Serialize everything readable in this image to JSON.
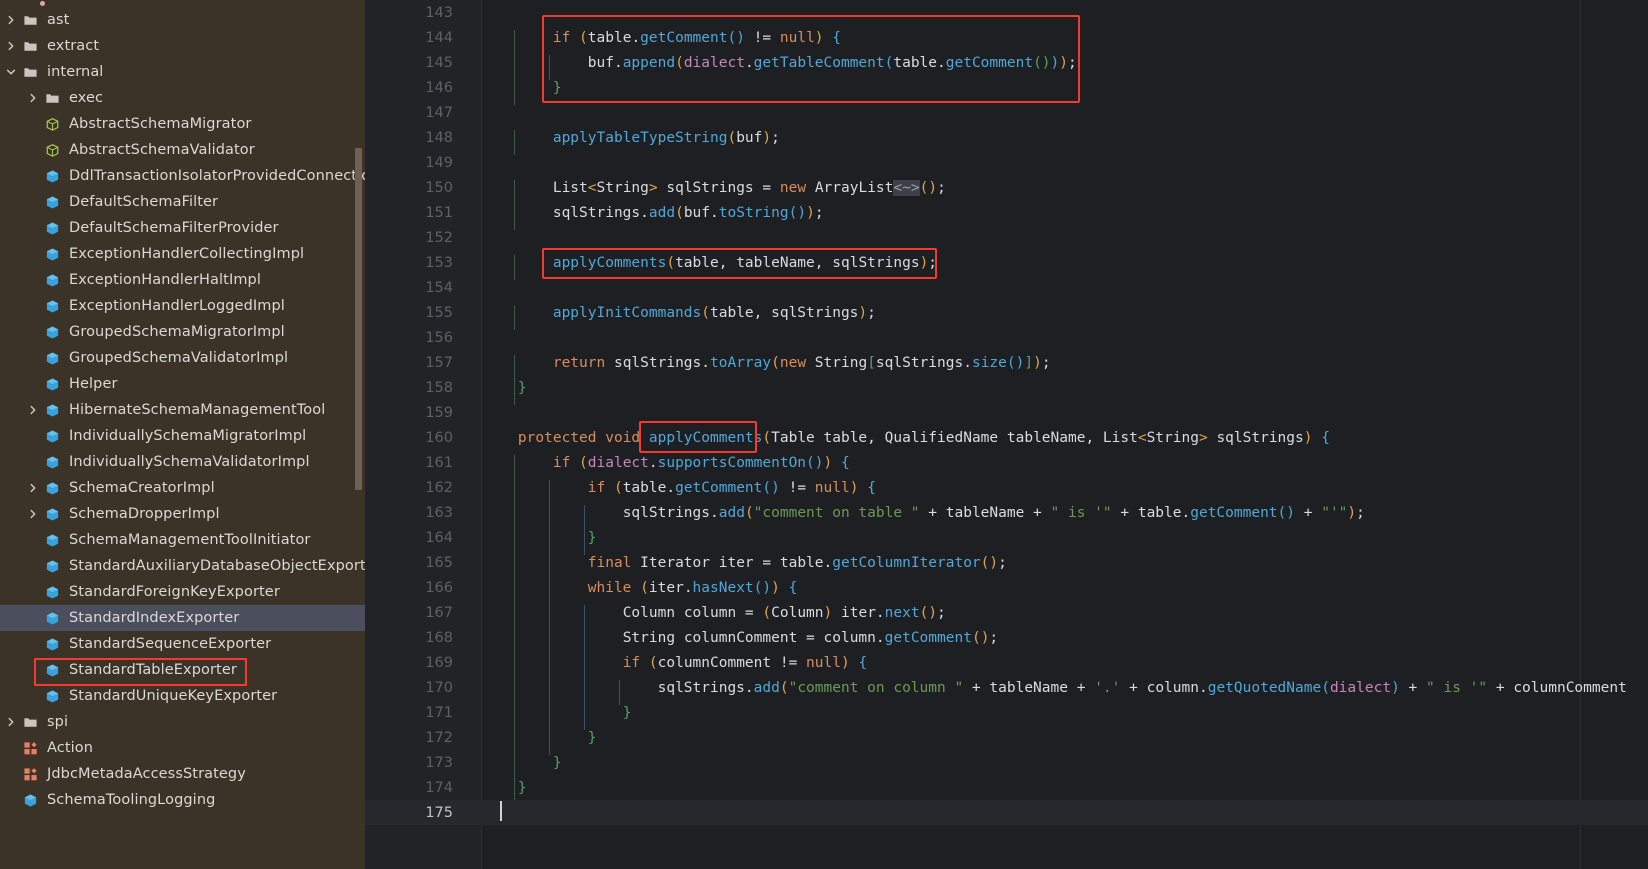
{
  "sidebar": {
    "bg_color": "#3b3228",
    "selected_bg": "#4b4e5c",
    "highlight_color": "#f4392f",
    "items": [
      {
        "label": "ast",
        "icon": "folder-icon",
        "indent": 0,
        "chevron": "right",
        "state": "collapsed"
      },
      {
        "label": "extract",
        "icon": "folder-icon",
        "indent": 0,
        "chevron": "right",
        "state": "collapsed"
      },
      {
        "label": "internal",
        "icon": "folder-icon",
        "indent": 0,
        "chevron": "down",
        "state": "expanded"
      },
      {
        "label": "exec",
        "icon": "folder-icon",
        "indent": 1,
        "chevron": "right",
        "state": "collapsed"
      },
      {
        "label": "AbstractSchemaMigrator",
        "icon": "abstract-class-icon",
        "indent": 1,
        "chevron": "none"
      },
      {
        "label": "AbstractSchemaValidator",
        "icon": "abstract-class-icon",
        "indent": 1,
        "chevron": "none"
      },
      {
        "label": "DdlTransactionIsolatorProvidedConnectionImpl",
        "icon": "class-icon",
        "indent": 1,
        "chevron": "none"
      },
      {
        "label": "DefaultSchemaFilter",
        "icon": "class-icon",
        "indent": 1,
        "chevron": "none"
      },
      {
        "label": "DefaultSchemaFilterProvider",
        "icon": "class-icon",
        "indent": 1,
        "chevron": "none"
      },
      {
        "label": "ExceptionHandlerCollectingImpl",
        "icon": "class-icon",
        "indent": 1,
        "chevron": "none"
      },
      {
        "label": "ExceptionHandlerHaltImpl",
        "icon": "class-icon",
        "indent": 1,
        "chevron": "none"
      },
      {
        "label": "ExceptionHandlerLoggedImpl",
        "icon": "class-icon",
        "indent": 1,
        "chevron": "none"
      },
      {
        "label": "GroupedSchemaMigratorImpl",
        "icon": "class-icon",
        "indent": 1,
        "chevron": "none"
      },
      {
        "label": "GroupedSchemaValidatorImpl",
        "icon": "class-icon",
        "indent": 1,
        "chevron": "none"
      },
      {
        "label": "Helper",
        "icon": "class-icon",
        "indent": 1,
        "chevron": "none"
      },
      {
        "label": "HibernateSchemaManagementTool",
        "icon": "class-icon",
        "indent": 1,
        "chevron": "right",
        "state": "collapsed"
      },
      {
        "label": "IndividuallySchemaMigratorImpl",
        "icon": "class-icon",
        "indent": 1,
        "chevron": "none"
      },
      {
        "label": "IndividuallySchemaValidatorImpl",
        "icon": "class-icon",
        "indent": 1,
        "chevron": "none"
      },
      {
        "label": "SchemaCreatorImpl",
        "icon": "class-icon",
        "indent": 1,
        "chevron": "right",
        "state": "collapsed"
      },
      {
        "label": "SchemaDropperImpl",
        "icon": "class-icon",
        "indent": 1,
        "chevron": "right",
        "state": "collapsed"
      },
      {
        "label": "SchemaManagementToolInitiator",
        "icon": "class-icon",
        "indent": 1,
        "chevron": "none"
      },
      {
        "label": "StandardAuxiliaryDatabaseObjectExporter",
        "icon": "class-icon",
        "indent": 1,
        "chevron": "none"
      },
      {
        "label": "StandardForeignKeyExporter",
        "icon": "class-icon",
        "indent": 1,
        "chevron": "none"
      },
      {
        "label": "StandardIndexExporter",
        "icon": "class-icon",
        "indent": 1,
        "chevron": "none",
        "selected": true
      },
      {
        "label": "StandardSequenceExporter",
        "icon": "class-icon",
        "indent": 1,
        "chevron": "none"
      },
      {
        "label": "StandardTableExporter",
        "icon": "class-icon",
        "indent": 1,
        "chevron": "none",
        "boxed": true
      },
      {
        "label": "StandardUniqueKeyExporter",
        "icon": "class-icon",
        "indent": 1,
        "chevron": "none"
      },
      {
        "label": "spi",
        "icon": "folder-icon",
        "indent": 0,
        "chevron": "right",
        "state": "collapsed"
      },
      {
        "label": "Action",
        "icon": "enum-icon",
        "indent": 0,
        "chevron": "none"
      },
      {
        "label": "JdbcMetadaAccessStrategy",
        "icon": "enum-icon",
        "indent": 0,
        "chevron": "none"
      },
      {
        "label": "SchemaToolingLogging",
        "icon": "class-icon",
        "indent": 0,
        "chevron": "none"
      }
    ]
  },
  "editor": {
    "background": "#1e1f23",
    "gutter_background": "#222327",
    "active_line": 175,
    "first_line": 143,
    "last_line": 175,
    "colors": {
      "keyword": "#d98d5b",
      "string": "#6a9955",
      "method": "#4fa8d8",
      "field": "#c586c0",
      "plain": "#d8dbe0",
      "line_number": "#5d6066",
      "highlight_box": "#f4392f"
    },
    "line_numbers": [
      143,
      144,
      145,
      146,
      147,
      148,
      149,
      150,
      151,
      152,
      153,
      154,
      155,
      156,
      157,
      158,
      159,
      160,
      161,
      162,
      163,
      164,
      165,
      166,
      167,
      168,
      169,
      170,
      171,
      172,
      173,
      174,
      175
    ],
    "code_lines": [
      {
        "n": 143,
        "text": ""
      },
      {
        "n": 144,
        "text": "        if (table.getComment() != null) {"
      },
      {
        "n": 145,
        "text": "            buf.append(dialect.getTableComment(table.getComment()));"
      },
      {
        "n": 146,
        "text": "        }"
      },
      {
        "n": 147,
        "text": ""
      },
      {
        "n": 148,
        "text": "        applyTableTypeString(buf);"
      },
      {
        "n": 149,
        "text": ""
      },
      {
        "n": 150,
        "text": "        List<String> sqlStrings = new ArrayList<~>();"
      },
      {
        "n": 151,
        "text": "        sqlStrings.add(buf.toString());"
      },
      {
        "n": 152,
        "text": ""
      },
      {
        "n": 153,
        "text": "        applyComments(table, tableName, sqlStrings);"
      },
      {
        "n": 154,
        "text": ""
      },
      {
        "n": 155,
        "text": "        applyInitCommands(table, sqlStrings);"
      },
      {
        "n": 156,
        "text": ""
      },
      {
        "n": 157,
        "text": "        return sqlStrings.toArray(new String[sqlStrings.size()]);"
      },
      {
        "n": 158,
        "text": "    }"
      },
      {
        "n": 159,
        "text": ""
      },
      {
        "n": 160,
        "text": "    protected void applyComments(Table table, QualifiedName tableName, List<String> sqlStrings) {"
      },
      {
        "n": 161,
        "text": "        if (dialect.supportsCommentOn()) {"
      },
      {
        "n": 162,
        "text": "            if (table.getComment() != null) {"
      },
      {
        "n": 163,
        "text": "                sqlStrings.add(\"comment on table \" + tableName + \" is '\" + table.getComment() + \"'\");"
      },
      {
        "n": 164,
        "text": "            }"
      },
      {
        "n": 165,
        "text": "            final Iterator iter = table.getColumnIterator();"
      },
      {
        "n": 166,
        "text": "            while (iter.hasNext()) {"
      },
      {
        "n": 167,
        "text": "                Column column = (Column) iter.next();"
      },
      {
        "n": 168,
        "text": "                String columnComment = column.getComment();"
      },
      {
        "n": 169,
        "text": "                if (columnComment != null) {"
      },
      {
        "n": 170,
        "text": "                    sqlStrings.add(\"comment on column \" + tableName + '.' + column.getQuotedName(dialect) + \" is '\" + columnComment"
      },
      {
        "n": 171,
        "text": "                }"
      },
      {
        "n": 172,
        "text": "            }"
      },
      {
        "n": 173,
        "text": "        }"
      },
      {
        "n": 174,
        "text": "    }"
      },
      {
        "n": 175,
        "text": ""
      }
    ],
    "annotations": [
      {
        "name": "box-if-table-getcomment",
        "lines": "144-146"
      },
      {
        "name": "box-applycomments-call",
        "lines": "153"
      },
      {
        "name": "box-applycomments-decl",
        "lines": "160"
      }
    ]
  }
}
